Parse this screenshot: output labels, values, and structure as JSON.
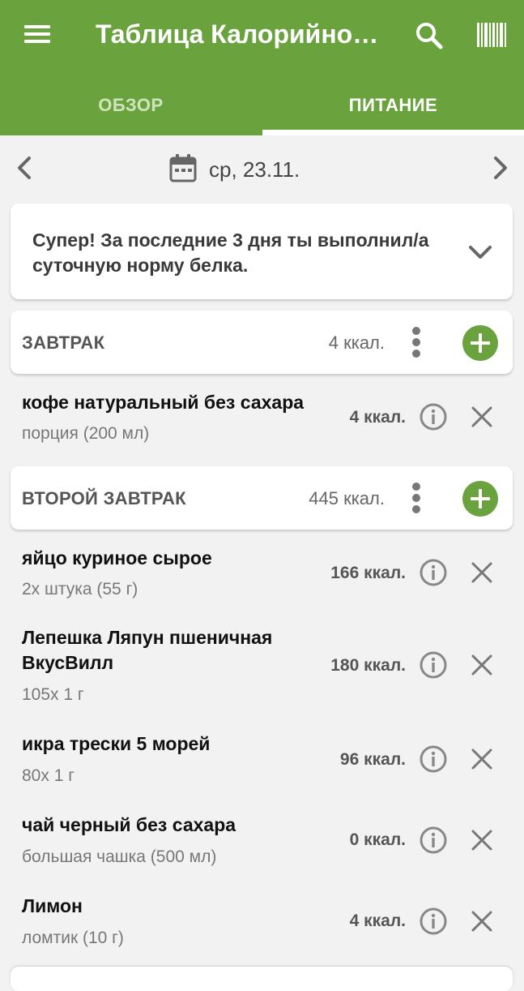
{
  "header": {
    "title": "Таблица Калорийно…",
    "background_color": "#6aa33d",
    "icons": {
      "menu": "menu-icon",
      "search": "search-icon",
      "barcode": "barcode-icon"
    }
  },
  "tabs": [
    {
      "label": "ОБЗОР",
      "active": false
    },
    {
      "label": "ПИТАНИЕ",
      "active": true
    }
  ],
  "date_nav": {
    "date": "ср, 23.11."
  },
  "tip": {
    "text": "Супер! За последние 3 дня ты выполнил/а суточную норму белка."
  },
  "meals": [
    {
      "title": "ЗАВТРАК",
      "kcal": "4 ккал.",
      "items": [
        {
          "name": "кофе натуральный без сахара",
          "portion": "порция (200 мл)",
          "kcal": "4 ккал."
        }
      ]
    },
    {
      "title": "ВТОРОЙ ЗАВТРАК",
      "kcal": "445 ккал.",
      "items": [
        {
          "name": "яйцо куриное сырое",
          "portion": "2x штука (55 г)",
          "kcal": "166 ккал."
        },
        {
          "name": "Лепешка Ляпун пшеничная ВкусВилл",
          "portion": "105x 1 г",
          "kcal": "180 ккал."
        },
        {
          "name": "икра трески 5 морей",
          "portion": "80x 1 г",
          "kcal": "96 ккал."
        },
        {
          "name": "чай черный без сахара",
          "portion": "большая чашка (500 мл)",
          "kcal": "0 ккал."
        },
        {
          "name": "Лимон",
          "portion": "ломтик (10 г)",
          "kcal": "4 ккал."
        }
      ]
    }
  ],
  "accent_color": "#6aa33d"
}
